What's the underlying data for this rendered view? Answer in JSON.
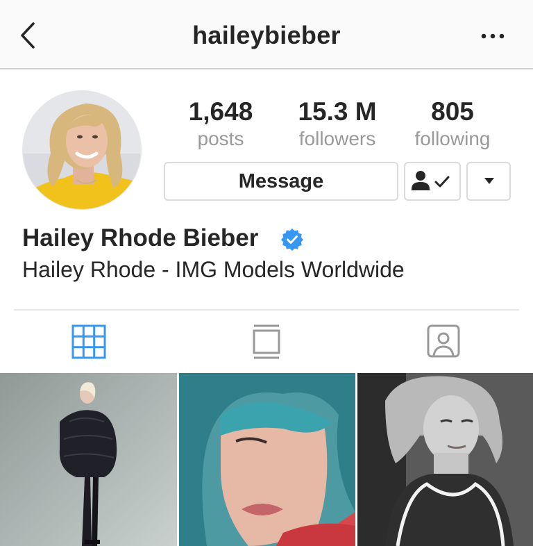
{
  "header": {
    "username": "haileybieber",
    "back_icon": "chevron-left-icon",
    "more_icon": "ellipsis-icon"
  },
  "profile": {
    "stats": {
      "posts": {
        "value": "1,648",
        "label": "posts"
      },
      "followers": {
        "value": "15.3 M",
        "label": "followers"
      },
      "following": {
        "value": "805",
        "label": "following"
      }
    },
    "buttons": {
      "message": "Message",
      "following_icon": "person-check-icon",
      "more_icon": "caret-down-icon"
    },
    "name": "Hailey Rhode Bieber",
    "verified": true,
    "bio": "Hailey Rhode - IMG Models Worldwide"
  },
  "tabs": [
    {
      "icon": "grid-icon",
      "active": true
    },
    {
      "icon": "feed-icon",
      "active": false
    },
    {
      "icon": "tagged-icon",
      "active": false
    }
  ],
  "colors": {
    "accent": "#3897f0",
    "text": "#262626",
    "muted": "#999999",
    "border": "#dbdbdb"
  }
}
